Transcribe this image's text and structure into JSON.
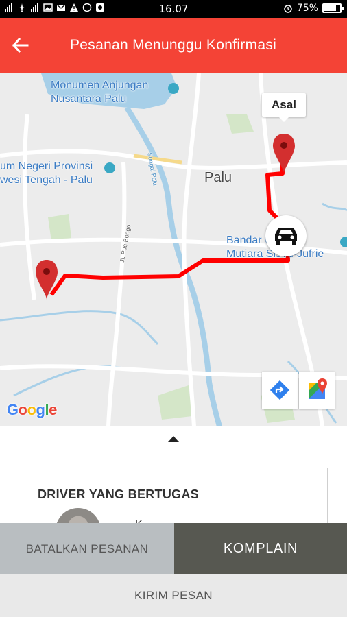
{
  "status_bar": {
    "left_icons": [
      "signal-icon",
      "airplane-icon",
      "signal-icon",
      "image-icon",
      "mail-icon",
      "warning-icon",
      "whatsapp-icon",
      "app-icon"
    ],
    "time": "16.07",
    "alarm_icon": "alarm-icon",
    "battery_percent": "75%",
    "battery_level": 0.75
  },
  "app_bar": {
    "back_icon": "arrow-back-icon",
    "title": "Pesanan Menunggu Konfirmasi",
    "color": "#f44336"
  },
  "map": {
    "labels": {
      "monument": "Monumen Anjungan\nNusantara Palu",
      "museum": "um Negeri Provinsi\nwesi Tengah - Palu",
      "city": "Palu",
      "airport": "Bandar Udara\nMutiara Sis Al-Jufrie",
      "road_vertical": "Jl. Pue Bongo",
      "road_river": "Sungai Palu"
    },
    "origin_tooltip": "Asal",
    "route_color": "#ff0000",
    "directions_icon": "directions-icon",
    "maps_icon": "google-maps-icon",
    "logo": "Google"
  },
  "sheet": {
    "handle_icon": "chevron-up-icon",
    "driver_card": {
      "title": "DRIVER YANG BERTUGAS",
      "name_partial": "K"
    }
  },
  "actions": {
    "cancel_label": "BATALKAN PESANAN",
    "complain_label": "KOMPLAIN",
    "send_label": "KIRIM PESAN"
  },
  "colors": {
    "cancel_bg": "#b9bec1",
    "complain_bg": "#575851",
    "send_bg": "#e9e9e9"
  }
}
